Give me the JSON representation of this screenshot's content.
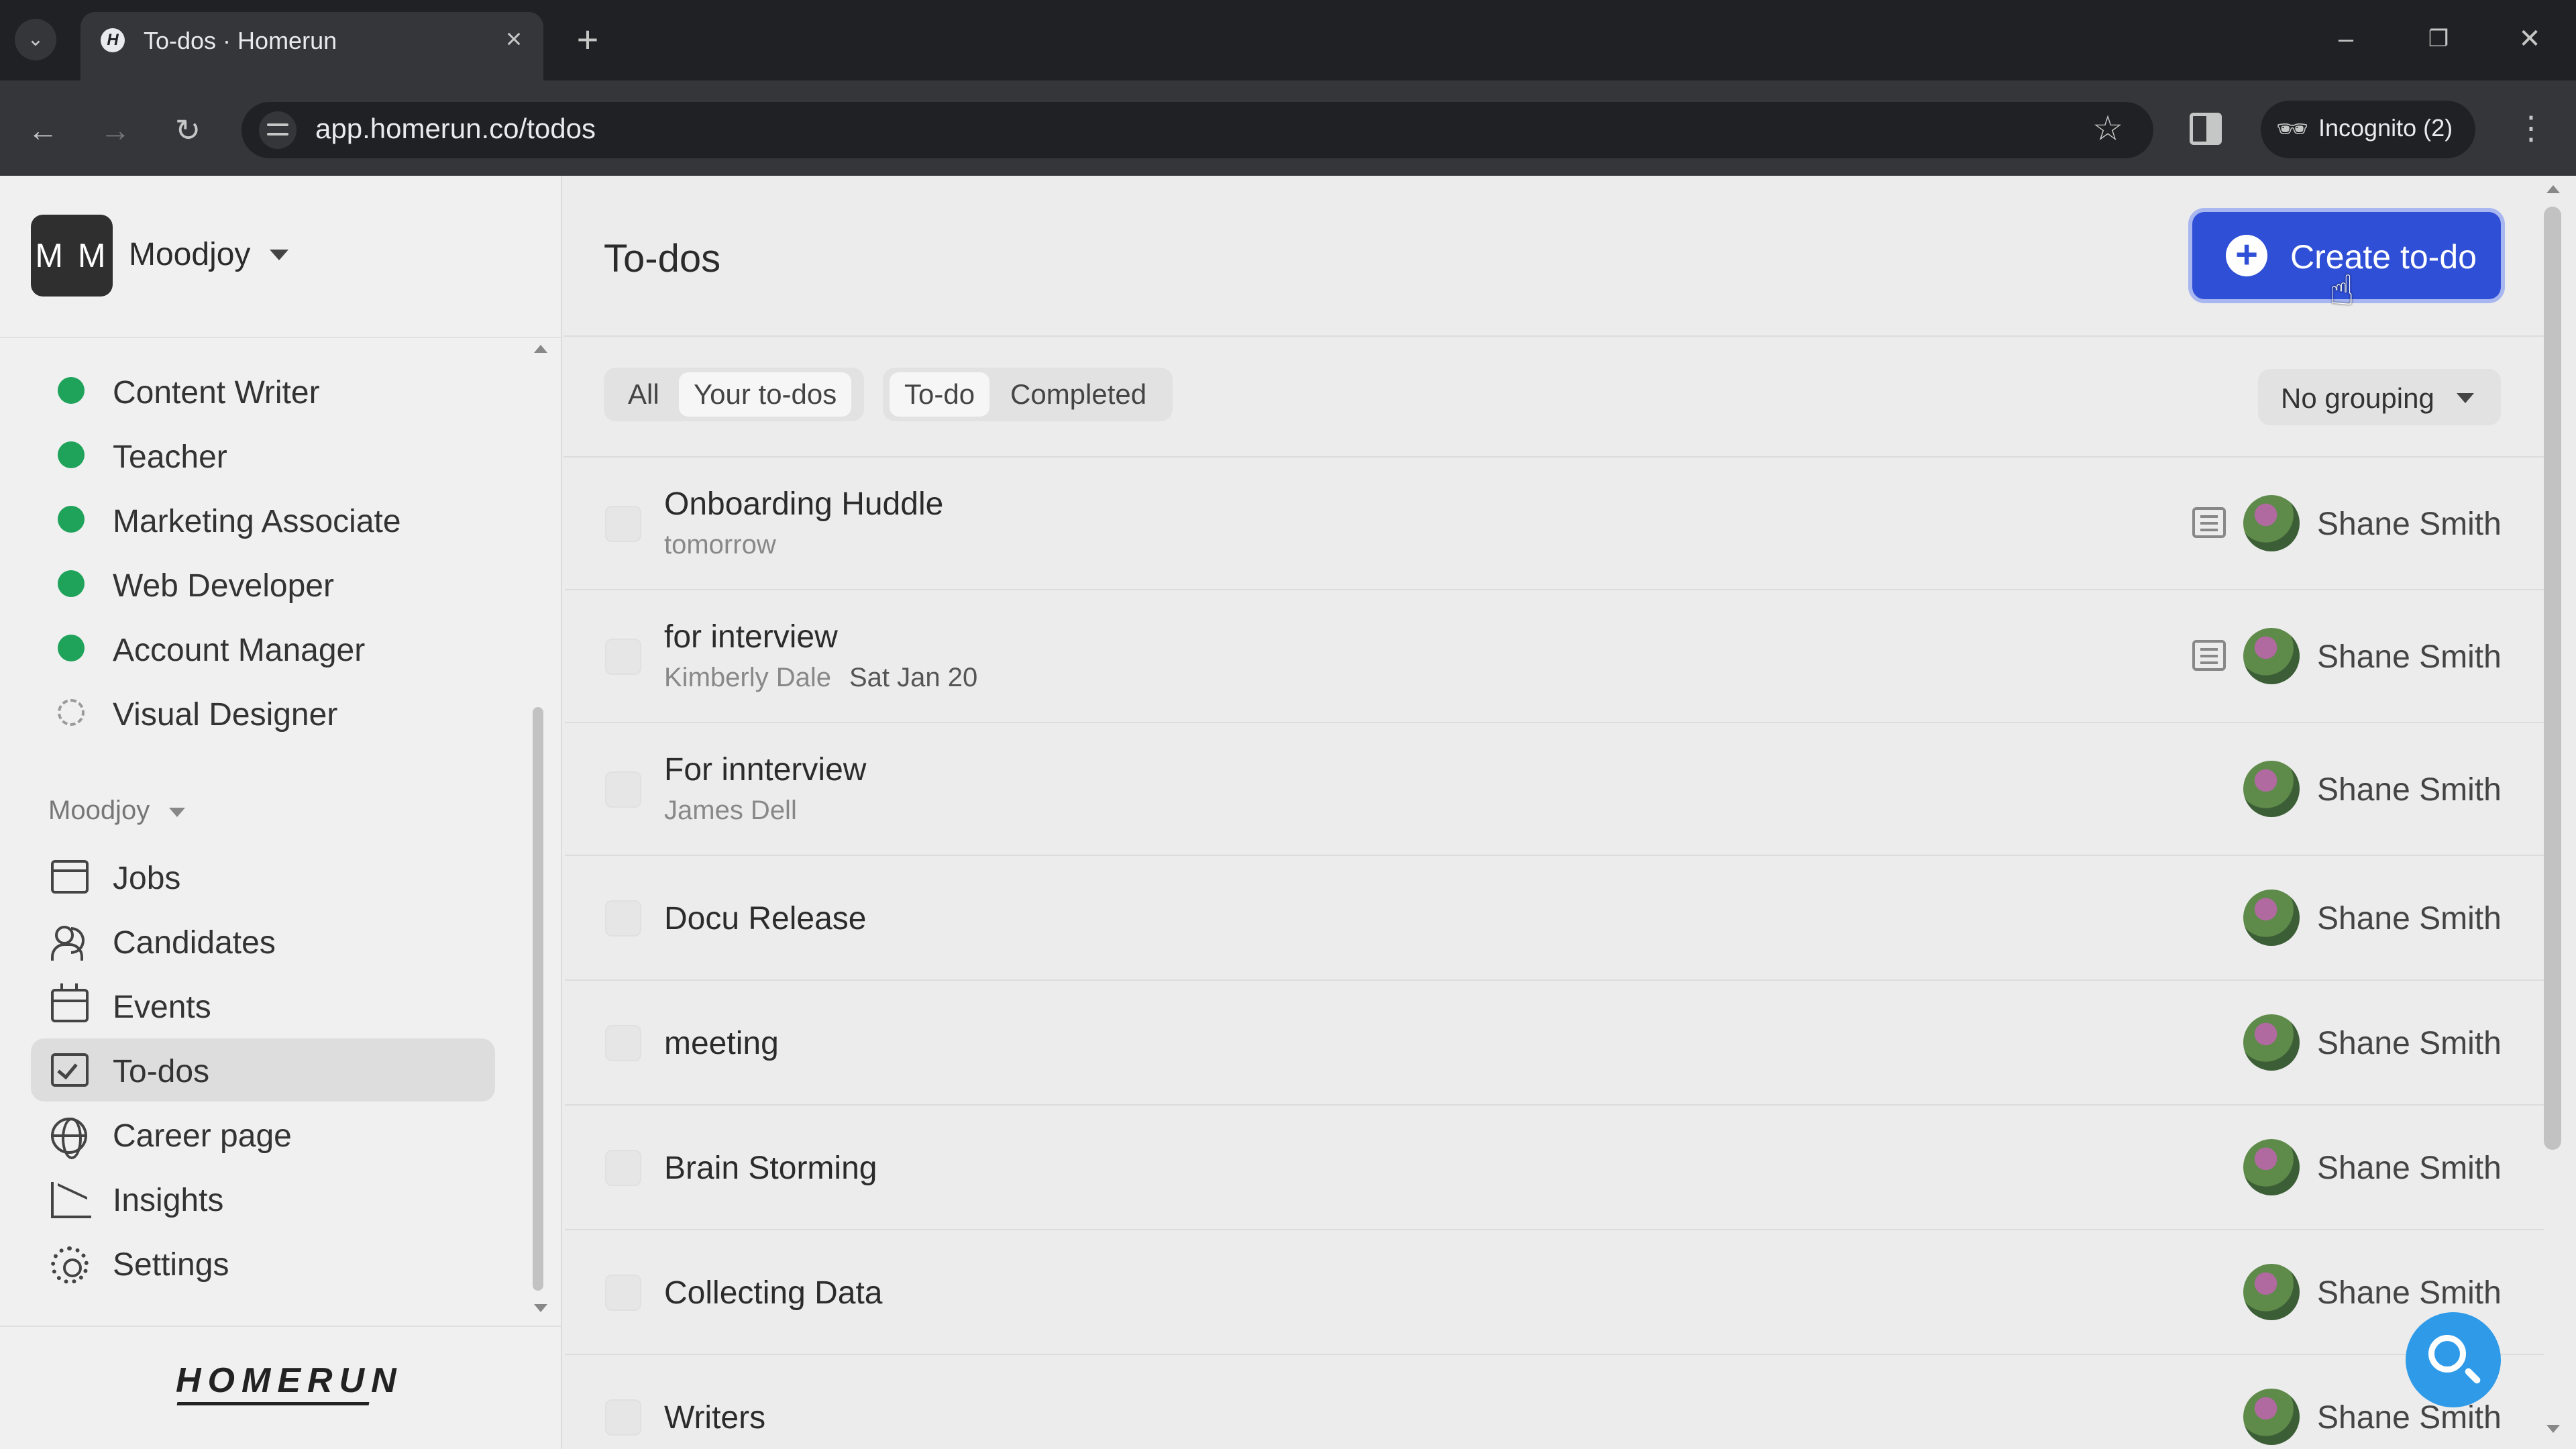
{
  "browser": {
    "tab_title": "To-dos · Homerun",
    "favicon": "H",
    "url": "app.homerun.co/todos",
    "incognito_label": "Incognito (2)"
  },
  "sidebar": {
    "workspace_initials": "M M",
    "workspace_name": "Moodjoy",
    "jobs": [
      {
        "label": "Content Writer",
        "status": "published"
      },
      {
        "label": "Teacher",
        "status": "published"
      },
      {
        "label": "Marketing Associate",
        "status": "published"
      },
      {
        "label": "Web Developer",
        "status": "published"
      },
      {
        "label": "Account Manager",
        "status": "published"
      },
      {
        "label": "Visual Designer",
        "status": "draft"
      }
    ],
    "section_label": "Moodjoy",
    "nav": [
      {
        "label": "Jobs",
        "icon": "briefcase-icon"
      },
      {
        "label": "Candidates",
        "icon": "people-icon"
      },
      {
        "label": "Events",
        "icon": "calendar-icon"
      },
      {
        "label": "To-dos",
        "icon": "checkbox-icon",
        "active": true
      },
      {
        "label": "Career page",
        "icon": "globe-icon"
      },
      {
        "label": "Insights",
        "icon": "chart-icon"
      },
      {
        "label": "Settings",
        "icon": "gear-icon"
      }
    ],
    "logo": "HOMERUN"
  },
  "main": {
    "title": "To-dos",
    "create_button": "Create to-do",
    "filters": {
      "scope": [
        "All",
        "Your to-dos"
      ],
      "scope_selected": "Your to-dos",
      "status": [
        "To-do",
        "Completed"
      ],
      "status_selected": "To-do"
    },
    "grouping": "No grouping",
    "todos": [
      {
        "title": "Onboarding Huddle",
        "sub": "tomorrow",
        "sub_date": "",
        "has_note": true,
        "assignee": "Shane Smith"
      },
      {
        "title": "for interview",
        "sub": "Kimberly Dale",
        "sub_date": "Sat Jan 20",
        "has_note": true,
        "assignee": "Shane Smith"
      },
      {
        "title": "For innterview",
        "sub": "James Dell",
        "sub_date": "",
        "has_note": false,
        "assignee": "Shane Smith"
      },
      {
        "title": "Docu Release",
        "sub": "",
        "sub_date": "",
        "has_note": false,
        "assignee": "Shane Smith"
      },
      {
        "title": "meeting",
        "sub": "",
        "sub_date": "",
        "has_note": false,
        "assignee": "Shane Smith"
      },
      {
        "title": "Brain Storming",
        "sub": "",
        "sub_date": "",
        "has_note": false,
        "assignee": "Shane Smith"
      },
      {
        "title": "Collecting Data",
        "sub": "",
        "sub_date": "",
        "has_note": false,
        "assignee": "Shane Smith"
      },
      {
        "title": "Writers",
        "sub": "",
        "sub_date": "",
        "has_note": false,
        "assignee": "Shane Smith"
      }
    ]
  },
  "colors": {
    "accent": "#2f4fd6",
    "published_dot": "#1fa35b",
    "help_fab": "#2f9be8"
  }
}
